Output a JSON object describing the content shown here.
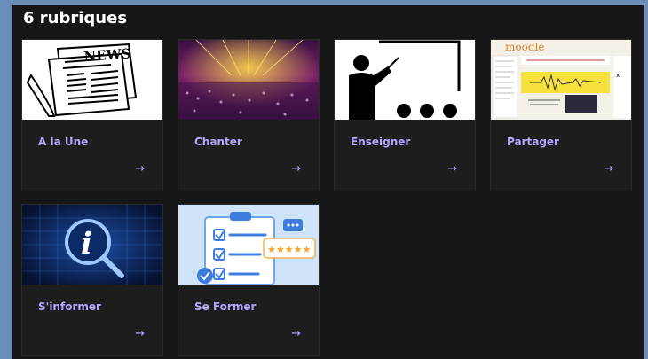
{
  "section": {
    "title": "6 rubriques"
  },
  "cards": [
    {
      "label": "A la Une",
      "arrow": "→",
      "thumb_icon": "newspaper-icon"
    },
    {
      "label": "Chanter",
      "arrow": "→",
      "thumb_icon": "concert-image"
    },
    {
      "label": "Enseigner",
      "arrow": "→",
      "thumb_icon": "teacher-board-icon"
    },
    {
      "label": "Partager",
      "arrow": "→",
      "thumb_icon": "moodle-screenshot",
      "moodle_logo": "moodle"
    },
    {
      "label": "S'informer",
      "arrow": "→",
      "thumb_icon": "info-magnifier-image"
    },
    {
      "label": "Se Former",
      "arrow": "→",
      "thumb_icon": "checklist-rating-image"
    }
  ],
  "colors": {
    "background": "#6b8cb6",
    "panel": "#161616",
    "card": "#1d1d1d",
    "accent": "#b3a8ff"
  }
}
